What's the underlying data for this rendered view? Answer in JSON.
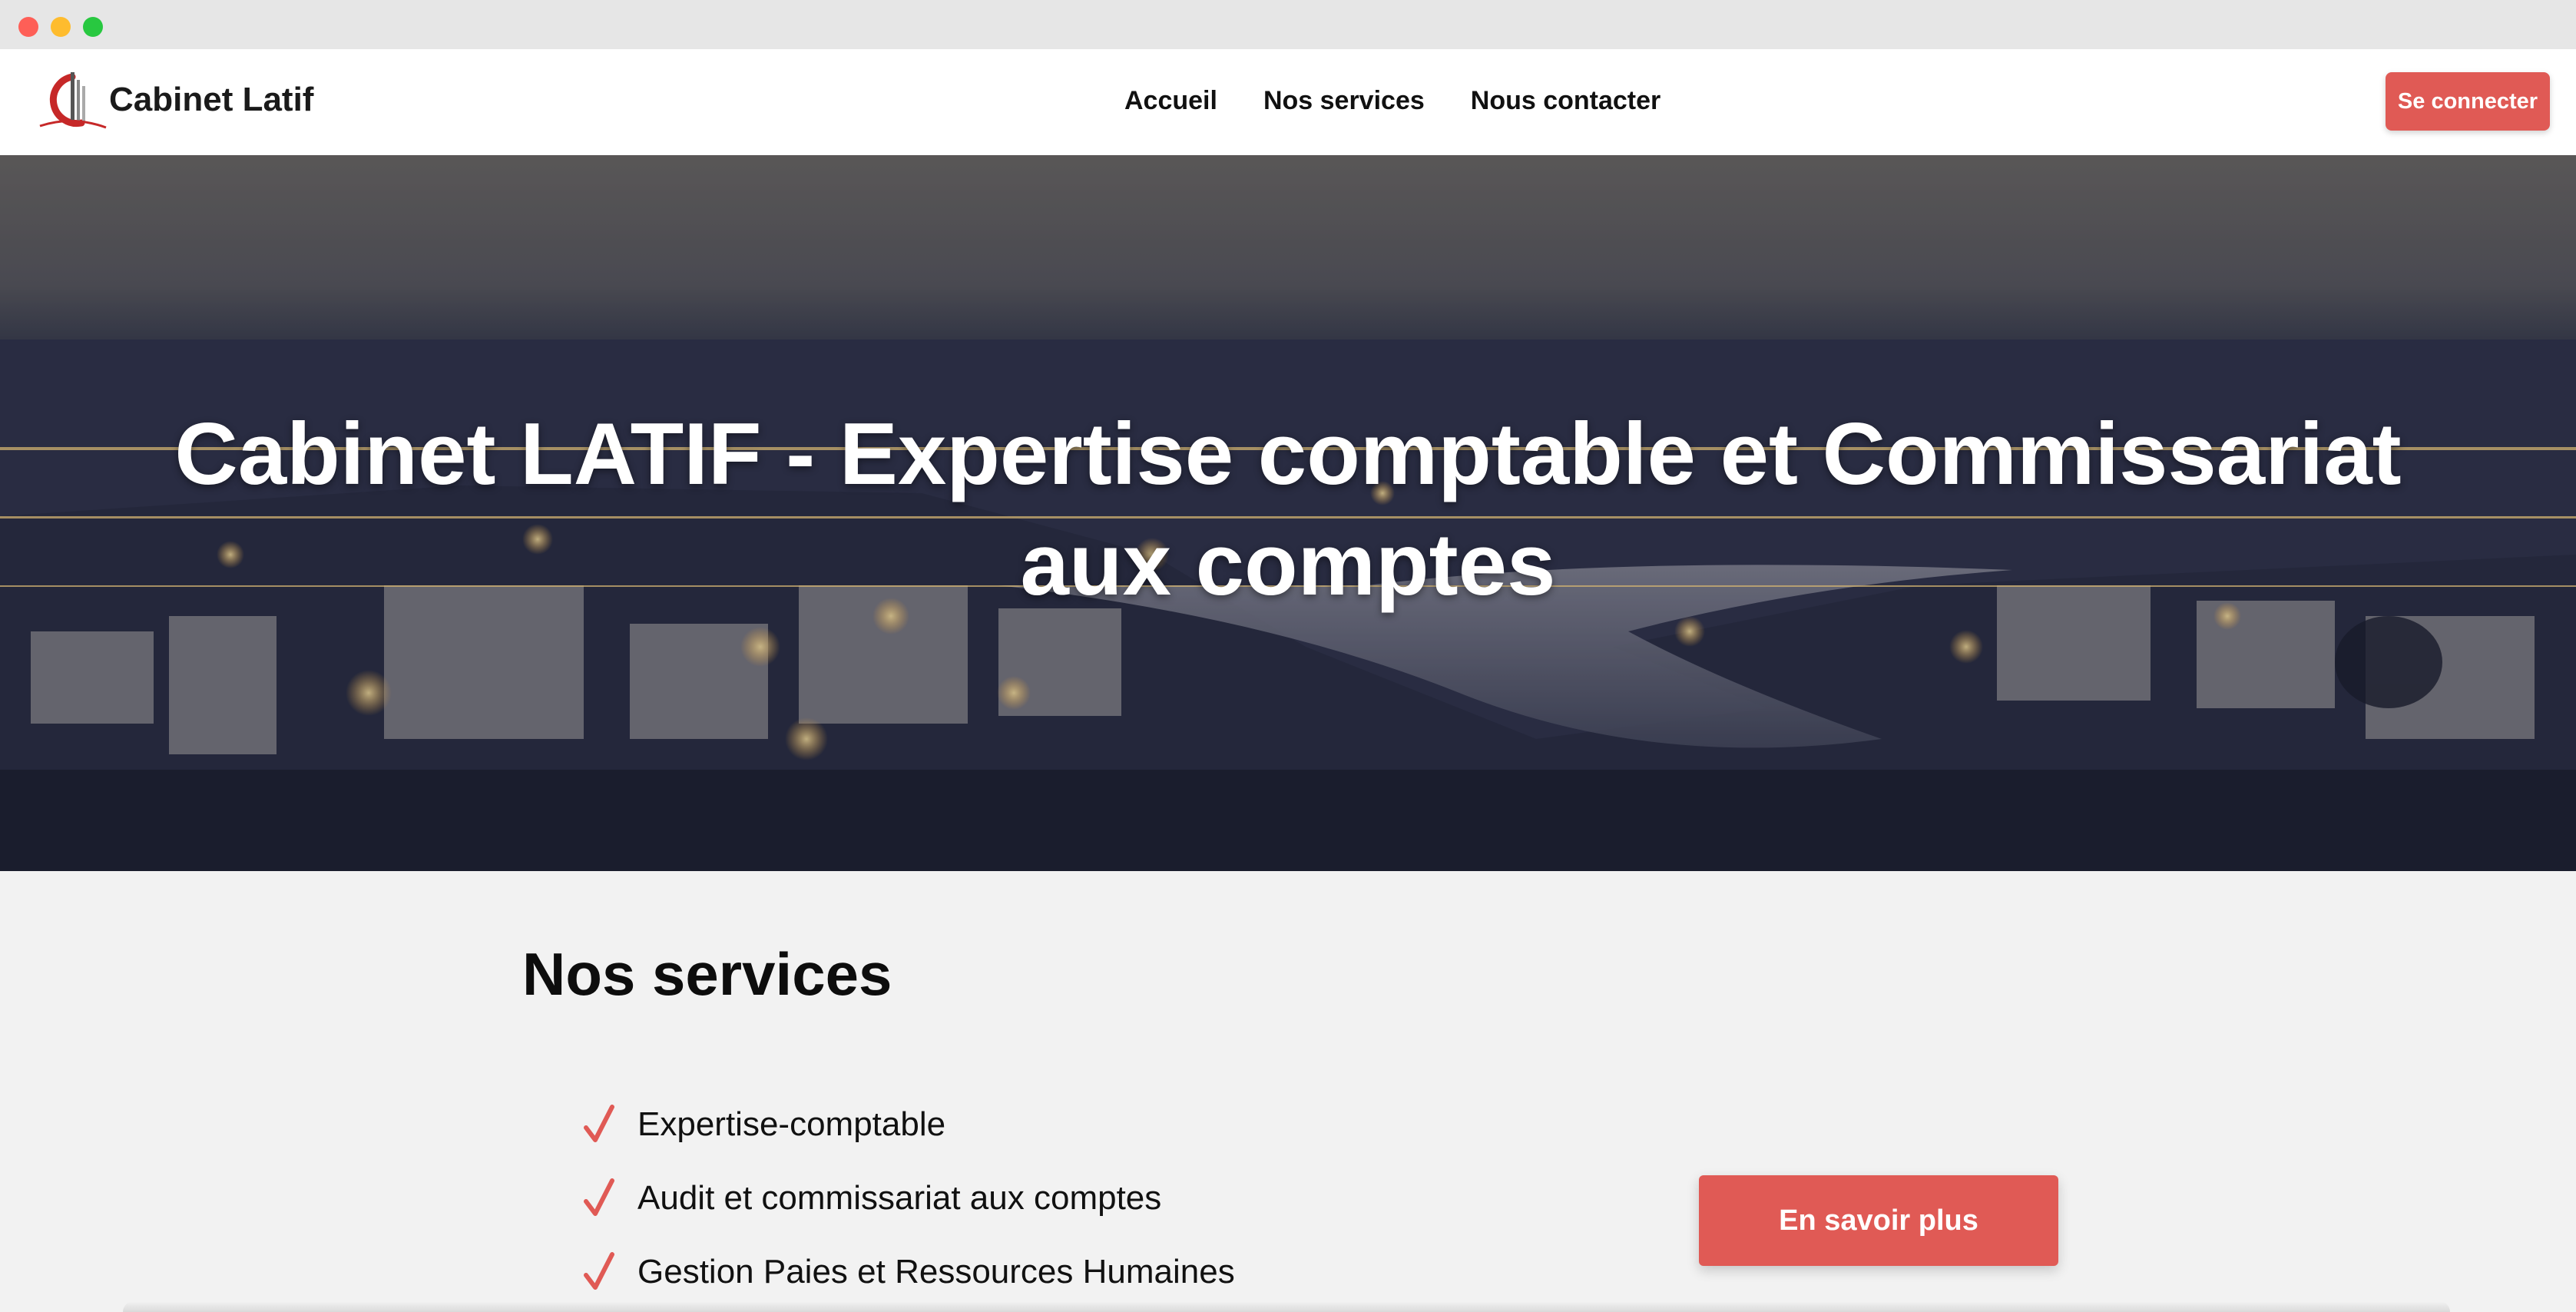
{
  "brand": {
    "name": "Cabinet Latif",
    "logo_icon": "cl-monogram-logo-icon",
    "accent_color": "#e05a55"
  },
  "nav": {
    "links": [
      {
        "label": "Accueil"
      },
      {
        "label": "Nos services"
      },
      {
        "label": "Nous contacter"
      }
    ],
    "login_label": "Se connecter"
  },
  "hero": {
    "title": "Cabinet LATIF - Expertise comptable et Commissariat aux comptes",
    "background": "night-city-river-panorama"
  },
  "services": {
    "heading": "Nos services",
    "check_icon": "checkmark-icon",
    "items": [
      {
        "label": "Expertise-comptable"
      },
      {
        "label": "Audit et commissariat aux comptes"
      },
      {
        "label": "Gestion Paies et Ressources Humaines"
      }
    ],
    "more_label": "En savoir plus"
  }
}
